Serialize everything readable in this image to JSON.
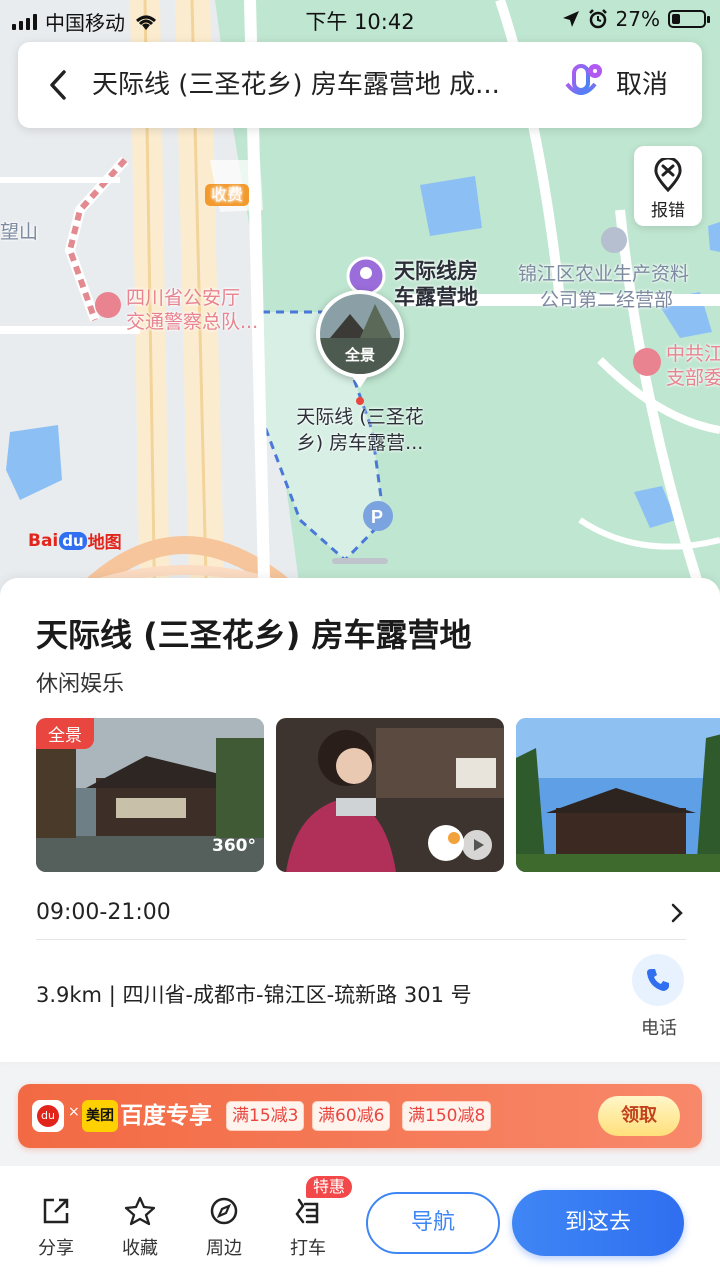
{
  "status_bar": {
    "carrier": "中国移动",
    "time": "下午 10:42",
    "battery": "27%",
    "battery_level": 0.27
  },
  "search": {
    "query": "天际线 (三圣花乡) 房车露营地 成...",
    "cancel_label": "取消"
  },
  "map": {
    "report_label": "报错",
    "toll_label": "收费",
    "labels": {
      "mountain": "望山",
      "police_1": "四川省公安厅",
      "police_2": "交通警察总队...",
      "poi_1": "天际线房",
      "poi_2": "车露营地",
      "company_1": "锦江区农业生产资料",
      "company_2": "公司第二经营部",
      "party_1": "中共江",
      "party_2": "支部委"
    },
    "pin_label": "全景",
    "pin_caption_1": "天际线 (三圣花",
    "pin_caption_2": "乡) 房车露营...",
    "baidu_logo": "Bai",
    "baidu_logo_du": "du",
    "baidu_logo_suffix": "地图"
  },
  "place": {
    "title": "天际线 (三圣花乡) 房车露营地",
    "category": "休闲娱乐",
    "photo_tag": "全景",
    "photo_360": "360°",
    "hours": "09:00-21:00",
    "address": "3.9km | 四川省-成都市-锦江区-琉新路 301 号",
    "phone_label": "电话"
  },
  "promo": {
    "du": "du",
    "x": "×",
    "partner": "美团",
    "title": "百度专享",
    "coupons": [
      "满15减3",
      "满60减6",
      "满150减8"
    ],
    "get_label": "领取"
  },
  "actions": {
    "share": "分享",
    "favorite": "收藏",
    "nearby": "周边",
    "taxi": "打车",
    "taxi_badge": "特惠",
    "navigate": "导航",
    "go_here": "到这去"
  },
  "colors": {
    "accent_blue": "#3f86f5",
    "promo_orange": "#f26a43",
    "map_green": "#bfe6d1",
    "water_blue": "#8cc0f5"
  }
}
